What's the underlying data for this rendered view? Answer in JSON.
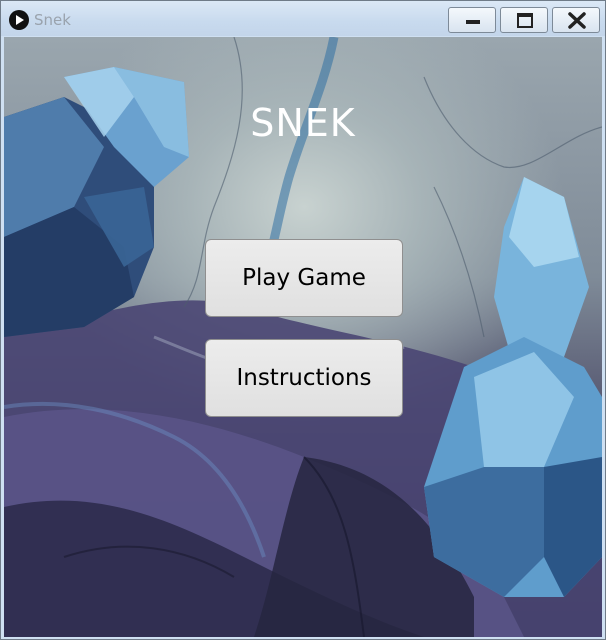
{
  "window": {
    "title": "Snek",
    "controls": [
      "minimize",
      "maximize",
      "close"
    ]
  },
  "icons": {
    "app": "play-circle-icon",
    "minimize": "minimize-icon",
    "maximize": "maximize-icon",
    "close": "close-icon"
  },
  "menu": {
    "title": "SNEK",
    "play_label": "Play Game",
    "instructions_label": "Instructions"
  },
  "colors": {
    "title_text": "#ffffff",
    "button_bg": "#e6e6e6",
    "crystal_blue": "#6fa8cf",
    "shadow_purple": "#3d3a66"
  }
}
